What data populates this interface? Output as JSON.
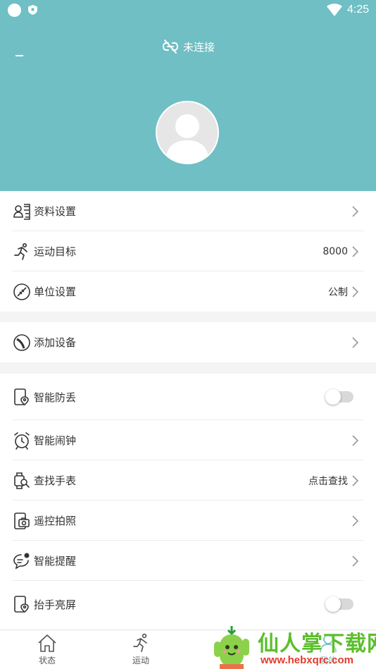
{
  "status_bar": {
    "time": "4:25"
  },
  "header": {
    "connection_text": "未连接",
    "color": "#6fbfc4"
  },
  "settings": {
    "group1": [
      {
        "label": "资料设置",
        "value": "",
        "icon": "profile-card-icon"
      },
      {
        "label": "运动目标",
        "value": "8000",
        "icon": "running-icon"
      },
      {
        "label": "单位设置",
        "value": "公制",
        "icon": "ruler-icon"
      }
    ],
    "group2": [
      {
        "label": "添加设备",
        "value": "",
        "icon": "device-icon"
      }
    ],
    "group3": [
      {
        "label": "智能防丢",
        "type": "toggle",
        "on": false,
        "icon": "anti-lost-icon"
      },
      {
        "label": "智能闹钟",
        "value": "",
        "icon": "alarm-clock-icon"
      },
      {
        "label": "查找手表",
        "value": "点击查找",
        "icon": "watch-search-icon"
      },
      {
        "label": "遥控拍照",
        "value": "",
        "icon": "remote-camera-icon"
      },
      {
        "label": "智能提醒",
        "value": "",
        "icon": "message-reminder-icon"
      },
      {
        "label": "抬手亮屏",
        "type": "toggle",
        "on": false,
        "icon": "raise-wake-icon"
      }
    ]
  },
  "tabs": [
    {
      "label": "状态",
      "icon": "home-icon"
    },
    {
      "label": "运动",
      "icon": "running-icon"
    },
    {
      "label": "我的",
      "icon": "profile-icon"
    }
  ],
  "watermark": {
    "title": "仙人掌下载网",
    "url": "www.hebxqrc.com"
  }
}
